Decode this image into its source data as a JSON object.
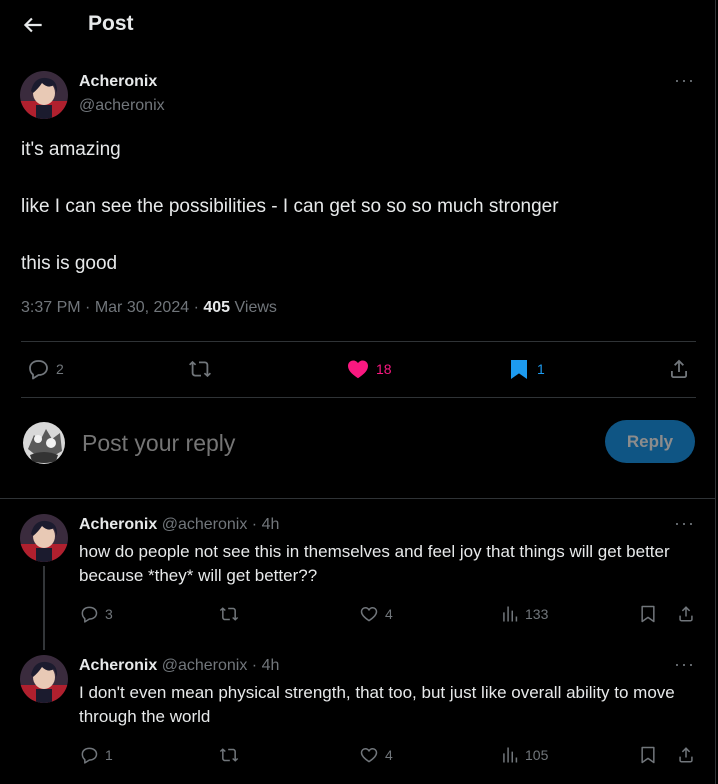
{
  "header": {
    "title": "Post"
  },
  "post": {
    "author_name": "Acheronix",
    "author_handle": "@acheronix",
    "lines": [
      "it's amazing",
      "like I can see the possibilities - I can get so so so much stronger",
      "this is good"
    ],
    "time": "3:37 PM",
    "separator": "·",
    "date": "Mar 30, 2024",
    "views_count": "405",
    "views_label": "Views",
    "replies": "2",
    "likes": "18",
    "bookmarks": "1",
    "colors": {
      "like": "#f91880",
      "bookmark": "#1d9bf0"
    }
  },
  "composer": {
    "placeholder": "Post your reply",
    "reply_button": "Reply"
  },
  "replies": [
    {
      "author_name": "Acheronix",
      "author_handle": "@acheronix",
      "separator": "·",
      "age": "4h",
      "text": "how do people not see this in themselves and feel joy that things will get better because *they* will get better??",
      "replies": "3",
      "likes": "4",
      "views": "133"
    },
    {
      "author_name": "Acheronix",
      "author_handle": "@acheronix",
      "separator": "·",
      "age": "4h",
      "text": "I don't even mean physical strength, that too, but just like overall ability to move through the world",
      "replies": "1",
      "likes": "4",
      "views": "105"
    }
  ],
  "icons": {
    "back": "arrow-left-icon",
    "more": "more-dots-icon",
    "reply": "speech-bubble-icon",
    "repost": "repost-arrows-icon",
    "like": "heart-icon",
    "bookmark": "bookmark-icon",
    "share": "share-upload-icon",
    "views": "bar-chart-icon"
  }
}
